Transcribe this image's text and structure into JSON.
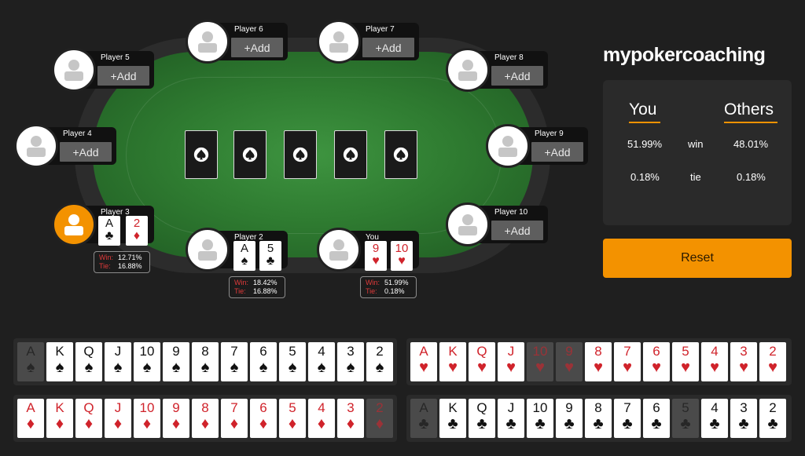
{
  "app": {
    "logo": "mypokercoaching",
    "add_label": "+Add",
    "reset_label": "Reset",
    "accent_color": "#f39200"
  },
  "seats": [
    {
      "name": "Player 6",
      "state": "empty"
    },
    {
      "name": "Player 7",
      "state": "empty"
    },
    {
      "name": "Player 5",
      "state": "empty"
    },
    {
      "name": "Player 8",
      "state": "empty"
    },
    {
      "name": "Player 4",
      "state": "empty"
    },
    {
      "name": "Player 9",
      "state": "empty"
    },
    {
      "name": "Player 3",
      "state": "filled",
      "cards": [
        {
          "rank": "A",
          "suit": "♣"
        },
        {
          "rank": "2",
          "suit": "♦"
        }
      ],
      "win_label": "Win:",
      "win": "12.71%",
      "tie_label": "Tie:",
      "tie": "16.88%"
    },
    {
      "name": "Player 10",
      "state": "empty"
    },
    {
      "name": "Player 2",
      "state": "filled",
      "cards": [
        {
          "rank": "A",
          "suit": "♠"
        },
        {
          "rank": "5",
          "suit": "♣"
        }
      ],
      "win_label": "Win:",
      "win": "18.42%",
      "tie_label": "Tie:",
      "tie": "16.88%"
    },
    {
      "name": "You",
      "state": "filled",
      "cards": [
        {
          "rank": "9",
          "suit": "♥"
        },
        {
          "rank": "10",
          "suit": "♥"
        }
      ],
      "win_label": "Win:",
      "win": "51.99%",
      "tie_label": "Tie:",
      "tie": "0.18%"
    }
  ],
  "board": {
    "slots": 5,
    "card_back_icon": "spade-logo-icon"
  },
  "stats": {
    "you_header": "You",
    "others_header": "Others",
    "rows": [
      {
        "you": "51.99%",
        "label": "win",
        "others": "48.01%"
      },
      {
        "you": "0.18%",
        "label": "tie",
        "others": "0.18%"
      }
    ]
  },
  "deck": {
    "ranks": [
      "A",
      "K",
      "Q",
      "J",
      "10",
      "9",
      "8",
      "7",
      "6",
      "5",
      "4",
      "3",
      "2"
    ],
    "spades": {
      "symbol": "♠",
      "color": "black",
      "used": [
        "A"
      ]
    },
    "hearts": {
      "symbol": "♥",
      "color": "red",
      "used": [
        "10",
        "9"
      ]
    },
    "diamonds": {
      "symbol": "♦",
      "color": "red",
      "used": [
        "2"
      ]
    },
    "clubs": {
      "symbol": "♣",
      "color": "black",
      "used": [
        "A",
        "5"
      ]
    }
  }
}
